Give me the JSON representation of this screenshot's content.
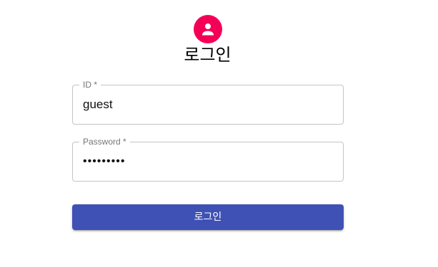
{
  "header": {
    "icon": "person-icon",
    "title": "로그인",
    "accent_color": "#f50057"
  },
  "form": {
    "id_field": {
      "label": "ID *",
      "value": "guest"
    },
    "password_field": {
      "label": "Password *",
      "value": "guestpass"
    },
    "submit_label": "로그인",
    "primary_color": "#3f51b5"
  }
}
